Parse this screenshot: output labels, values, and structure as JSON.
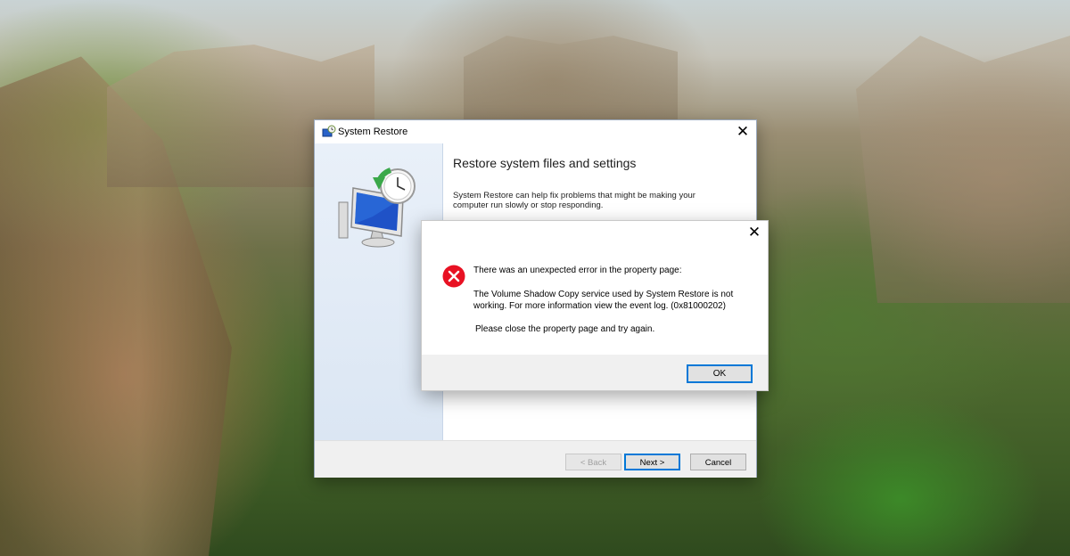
{
  "system_restore": {
    "title": "System Restore",
    "heading": "Restore system files and settings",
    "description": "System Restore can help fix problems that might be making your computer run slowly or stop responding.",
    "buttons": {
      "back": "< Back",
      "next": "Next >",
      "cancel": "Cancel"
    },
    "close_glyph": "✕"
  },
  "error_dialog": {
    "message_title": "There was an unexpected error in the property page:",
    "message_body": "The Volume Shadow Copy service used by System Restore is not working. For more information view the event log. (0x81000202)",
    "message_footer": "Please close the property page and try again.",
    "ok_label": "OK",
    "close_glyph": "✕"
  },
  "colors": {
    "accent": "#0078d7",
    "error_red": "#e81123",
    "sidebar": "#e3ecf7"
  },
  "icons": [
    "system-restore-app-icon",
    "computer-clock-illustration",
    "error-icon",
    "close-icon"
  ]
}
